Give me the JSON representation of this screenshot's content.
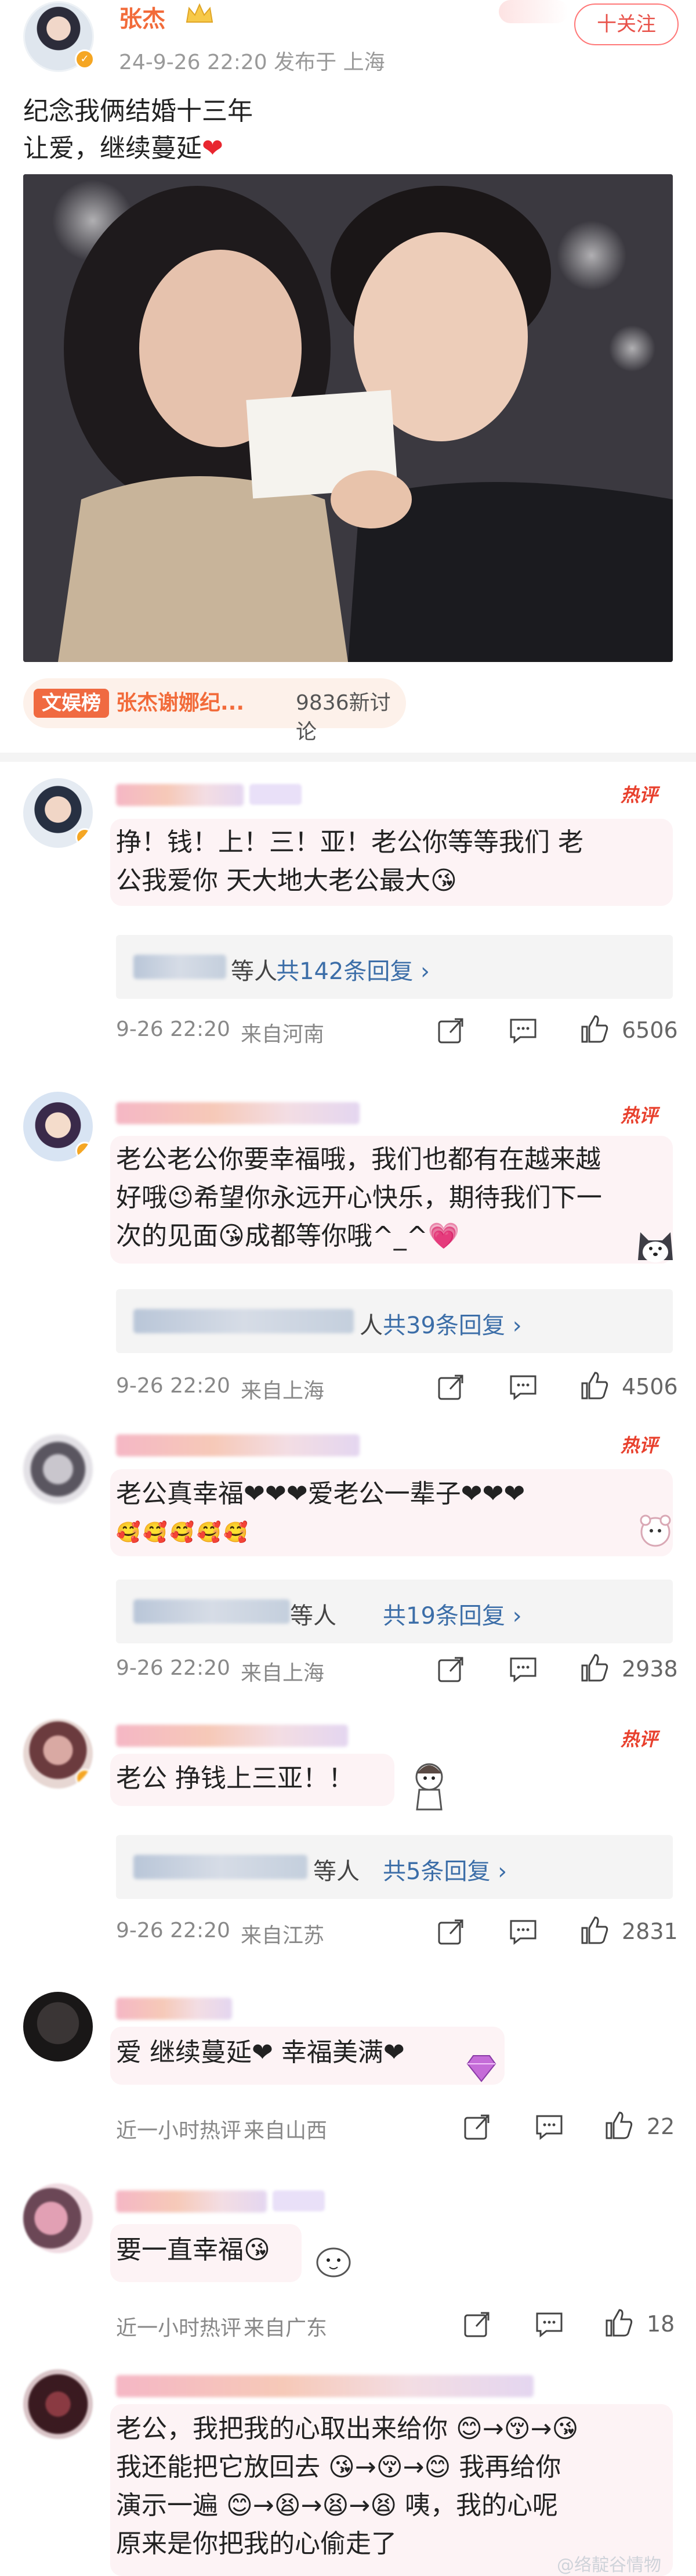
{
  "post": {
    "author": "张杰",
    "meta": "24-9-26 22:20  发布于 上海",
    "follow_label": "十关注",
    "text_line1": "纪念我俩结婚十三年",
    "text_line2": "让爱，继续蔓延",
    "heart": "❤",
    "photo_card_text": "",
    "topic": {
      "tag": "文娱榜",
      "title": "张杰谢娜纪...",
      "count": "9836新讨论"
    }
  },
  "comments": [
    {
      "hot": "热评",
      "text_line1": "挣！钱！上！三！亚！老公你等等我们 老",
      "text_line2": "公我爱你 天大地大老公最大😘",
      "reply_suffix": "等人",
      "reply_link": "共142条回复 ›",
      "time": "9-26 22:20",
      "location": "来自河南",
      "likes": "6506"
    },
    {
      "hot": "热评",
      "text_line1": "老公老公你要幸福哦，我们也都有在越来越",
      "text_line2": "好哦😉希望你永远开心快乐，期待我们下一",
      "text_line3": "次的见面😘成都等你哦^_^💗",
      "reply_suffix": "人",
      "reply_link": "共39条回复 ›",
      "time": "9-26 22:20",
      "location": "来自上海",
      "likes": "4506"
    },
    {
      "hot": "热评",
      "text_line1": "老公真幸福❤❤❤爱老公一辈子❤❤❤",
      "reply_suffix": "等人",
      "reply_link": "共19条回复 ›",
      "time": "9-26 22:20",
      "location": "来自上海",
      "likes": "2938"
    },
    {
      "hot": "热评",
      "text_line1": "老公 挣钱上三亚！！",
      "reply_suffix": "等人",
      "reply_link": "共5条回复 ›",
      "time": "9-26 22:20",
      "location": "来自江苏",
      "likes": "2831"
    },
    {
      "text_line1": "爱 继续蔓延❤ 幸福美满❤",
      "time": "近一小时热评",
      "location": "来自山西",
      "likes": "22"
    },
    {
      "text_line1": "要一直幸福😘",
      "time": "近一小时热评",
      "location": "来自广东",
      "likes": "18"
    },
    {
      "text_line1": "老公，我把我的心取出来给你 😊→😚→😘",
      "text_line2": "我还能把它放回去 😘→😚→😊 我再给你",
      "text_line3": "演示一遍 😊→😫→😫→😫 咦，我的心呢",
      "text_line4": "原来是你把我的心偷走了"
    }
  ],
  "watermark": "@络靛谷情物"
}
